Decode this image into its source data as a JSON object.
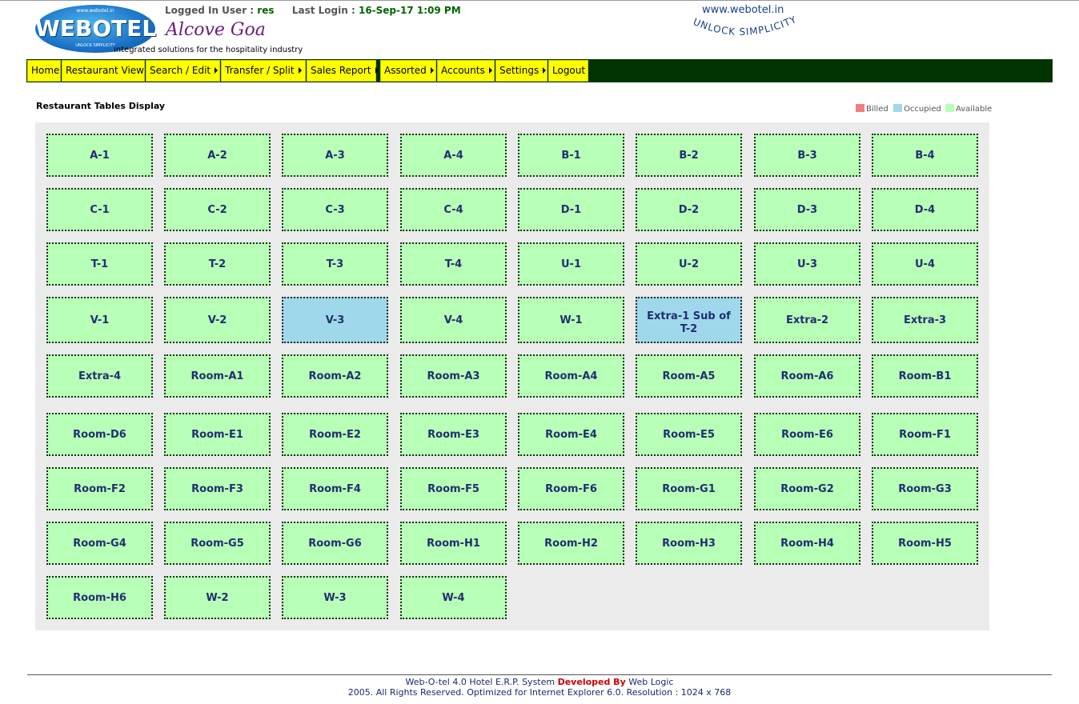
{
  "header": {
    "logo": {
      "small_url": "www.webotel.in",
      "brand": "WEBOTEL",
      "tagline": "UNLOCK SIMPLICITY"
    },
    "logged_in_label": "Logged In User :",
    "logged_in_user": "res",
    "last_login_label": "Last Login :",
    "last_login_value": "16-Sep-17 1:09 PM",
    "hotel_name": "Alcove Goa",
    "company_tagline": "integrated solutions for the hospitality industry",
    "site_url": "www.webotel.in",
    "slogan": "UNLOCK SIMPLICITY"
  },
  "nav": [
    {
      "label": "Home",
      "has_submenu": false
    },
    {
      "label": "Restaurant View",
      "has_submenu": false
    },
    {
      "label": "Search / Edit",
      "has_submenu": true
    },
    {
      "label": "Transfer / Split",
      "has_submenu": true
    },
    {
      "label": "Sales Report",
      "has_submenu": true
    },
    {
      "label": "Assorted",
      "has_submenu": true
    },
    {
      "label": "Accounts",
      "has_submenu": true
    },
    {
      "label": "Settings",
      "has_submenu": true
    },
    {
      "label": "Logout",
      "has_submenu": false
    }
  ],
  "page_title": "Restaurant Tables Display",
  "legend": [
    {
      "label": "Billed",
      "color": "#f08080"
    },
    {
      "label": "Occupied",
      "color": "#9fd8ea"
    },
    {
      "label": "Available",
      "color": "#b8ffb8"
    }
  ],
  "status_colors": {
    "available": "#b8ffb8",
    "occupied": "#9fd8ea",
    "billed": "#f08080"
  },
  "tables": [
    [
      {
        "name": "A-1",
        "status": "available"
      },
      {
        "name": "A-2",
        "status": "available"
      },
      {
        "name": "A-3",
        "status": "available"
      },
      {
        "name": "A-4",
        "status": "available"
      },
      {
        "name": "B-1",
        "status": "available"
      },
      {
        "name": "B-2",
        "status": "available"
      },
      {
        "name": "B-3",
        "status": "available"
      },
      {
        "name": "B-4",
        "status": "available"
      }
    ],
    [
      {
        "name": "C-1",
        "status": "available"
      },
      {
        "name": "C-2",
        "status": "available"
      },
      {
        "name": "C-3",
        "status": "available"
      },
      {
        "name": "C-4",
        "status": "available"
      },
      {
        "name": "D-1",
        "status": "available"
      },
      {
        "name": "D-2",
        "status": "available"
      },
      {
        "name": "D-3",
        "status": "available"
      },
      {
        "name": "D-4",
        "status": "available"
      }
    ],
    [
      {
        "name": "T-1",
        "status": "available"
      },
      {
        "name": "T-2",
        "status": "available"
      },
      {
        "name": "T-3",
        "status": "available"
      },
      {
        "name": "T-4",
        "status": "available"
      },
      {
        "name": "U-1",
        "status": "available"
      },
      {
        "name": "U-2",
        "status": "available"
      },
      {
        "name": "U-3",
        "status": "available"
      },
      {
        "name": "U-4",
        "status": "available"
      }
    ],
    [
      {
        "name": "V-1",
        "status": "available"
      },
      {
        "name": "V-2",
        "status": "available"
      },
      {
        "name": "V-3",
        "status": "occupied"
      },
      {
        "name": "V-4",
        "status": "available"
      },
      {
        "name": "W-1",
        "status": "available"
      },
      {
        "name": "Extra-1 Sub of T-2",
        "status": "occupied"
      },
      {
        "name": "Extra-2",
        "status": "available"
      },
      {
        "name": "Extra-3",
        "status": "available"
      }
    ],
    [
      {
        "name": "Extra-4",
        "status": "available"
      },
      {
        "name": "Room-A1",
        "status": "available"
      },
      {
        "name": "Room-A2",
        "status": "available"
      },
      {
        "name": "Room-A3",
        "status": "available"
      },
      {
        "name": "Room-A4",
        "status": "available"
      },
      {
        "name": "Room-A5",
        "status": "available"
      },
      {
        "name": "Room-A6",
        "status": "available"
      },
      {
        "name": "Room-B1",
        "status": "available"
      }
    ],
    [
      {
        "name": "Room-D6",
        "status": "available"
      },
      {
        "name": "Room-E1",
        "status": "available"
      },
      {
        "name": "Room-E2",
        "status": "available"
      },
      {
        "name": "Room-E3",
        "status": "available"
      },
      {
        "name": "Room-E4",
        "status": "available"
      },
      {
        "name": "Room-E5",
        "status": "available"
      },
      {
        "name": "Room-E6",
        "status": "available"
      },
      {
        "name": "Room-F1",
        "status": "available"
      }
    ],
    [
      {
        "name": "Room-F2",
        "status": "available"
      },
      {
        "name": "Room-F3",
        "status": "available"
      },
      {
        "name": "Room-F4",
        "status": "available"
      },
      {
        "name": "Room-F5",
        "status": "available"
      },
      {
        "name": "Room-F6",
        "status": "available"
      },
      {
        "name": "Room-G1",
        "status": "available"
      },
      {
        "name": "Room-G2",
        "status": "available"
      },
      {
        "name": "Room-G3",
        "status": "available"
      }
    ],
    [
      {
        "name": "Room-G4",
        "status": "available"
      },
      {
        "name": "Room-G5",
        "status": "available"
      },
      {
        "name": "Room-G6",
        "status": "available"
      },
      {
        "name": "Room-H1",
        "status": "available"
      },
      {
        "name": "Room-H2",
        "status": "available"
      },
      {
        "name": "Room-H3",
        "status": "available"
      },
      {
        "name": "Room-H4",
        "status": "available"
      },
      {
        "name": "Room-H5",
        "status": "available"
      }
    ],
    [
      {
        "name": "Room-H6",
        "status": "available"
      },
      {
        "name": "W-2",
        "status": "available"
      },
      {
        "name": "W-3",
        "status": "available"
      },
      {
        "name": "W-4",
        "status": "available"
      }
    ]
  ],
  "footer": {
    "line1_prefix": "Web-O-tel 4.0 Hotel E.R.P. System ",
    "line1_highlight": "Developed By",
    "line1_suffix": " Web Logic",
    "line2": "2005. All Rights Reserved. Optimized for Internet Explorer 6.0.  Resolution : 1024 x 768"
  }
}
